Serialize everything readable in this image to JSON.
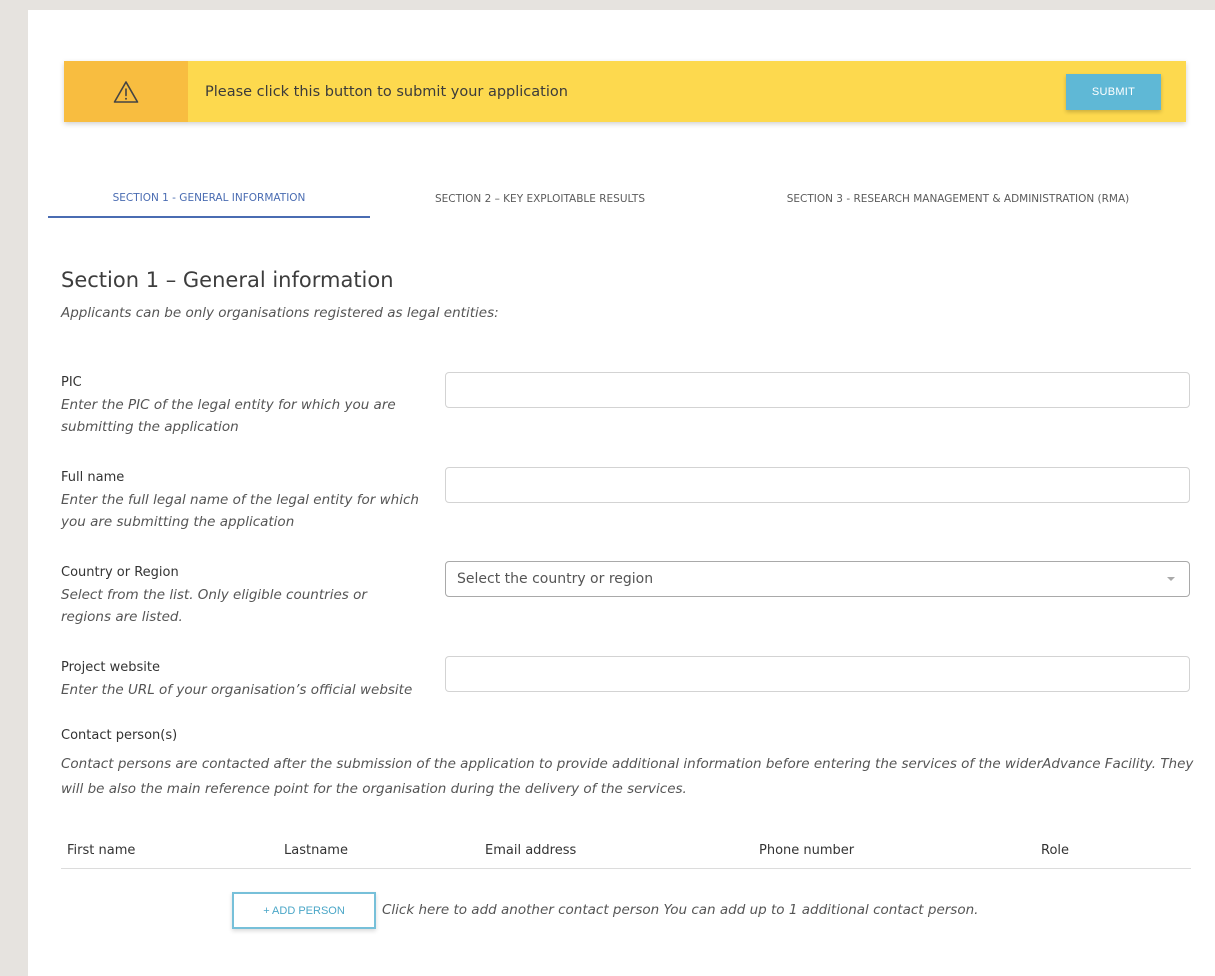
{
  "alert": {
    "icon": "warning-icon",
    "message": "Please click this button to submit your application",
    "submit_label": "SUBMIT"
  },
  "tabs": [
    {
      "label": "SECTION 1 - GENERAL INFORMATION",
      "active": true
    },
    {
      "label": "SECTION 2 – KEY EXPLOITABLE RESULTS",
      "active": false
    },
    {
      "label": "SECTION 3 - RESEARCH MANAGEMENT & ADMINISTRATION (RMA)",
      "active": false
    }
  ],
  "section": {
    "title": "Section 1 – General information",
    "subtitle": "Applicants can be only organisations registered as legal entities:"
  },
  "fields": {
    "pic": {
      "label": "PIC",
      "hint": "Enter the PIC of the legal entity for which you are submitting the application",
      "value": ""
    },
    "full_name": {
      "label": "Full name",
      "hint": "Enter the full legal name of the legal entity for which you are submitting the application",
      "value": ""
    },
    "country": {
      "label": "Country or Region",
      "hint": "Select from the list. Only eligible countries or regions are listed.",
      "placeholder": "Select the country or region"
    },
    "website": {
      "label": "Project website",
      "hint": "Enter the URL of your organisation’s official website",
      "value": ""
    }
  },
  "contacts": {
    "label": "Contact person(s)",
    "hint": "Contact persons are contacted after the submission of the application to provide additional information before entering the services of the widerAdvance Facility. They will be also the main reference point for the organisation during the delivery of the services.",
    "columns": [
      "First name",
      "Lastname",
      "Email address",
      "Phone number",
      "Role"
    ],
    "add_label": "+ ADD PERSON",
    "add_hint": "Click here to add another contact person You can add up to 1 additional contact person."
  },
  "colors": {
    "banner": "#fdd94e",
    "banner_icon_bg": "#f8bd40",
    "submit": "#5fb8d6",
    "tab_active": "#4a6cb2"
  }
}
